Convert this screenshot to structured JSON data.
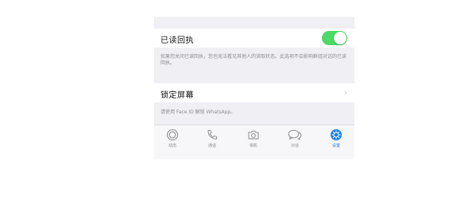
{
  "settings": {
    "read_receipts": {
      "label": "已读回执",
      "enabled": true,
      "note": "如果您关闭已读回执，您也无法看见其他人的读取状态。此选项不会影响群组对话的已读回执。"
    },
    "screen_lock": {
      "label": "锁定屏幕",
      "chevron": "›",
      "note": "请使用 Face ID 解锁 WhatsApp。"
    }
  },
  "tabbar": {
    "tabs": [
      {
        "label": "动态",
        "icon": "status-icon",
        "active": false
      },
      {
        "label": "通话",
        "icon": "phone-icon",
        "active": false
      },
      {
        "label": "相机",
        "icon": "camera-icon",
        "active": false
      },
      {
        "label": "对话",
        "icon": "chats-icon",
        "active": false
      },
      {
        "label": "设置",
        "icon": "settings-icon",
        "active": true
      }
    ]
  },
  "colors": {
    "toggle_on": "#4cd964",
    "accent": "#1a7ee8",
    "inactive": "#8e8e93"
  }
}
